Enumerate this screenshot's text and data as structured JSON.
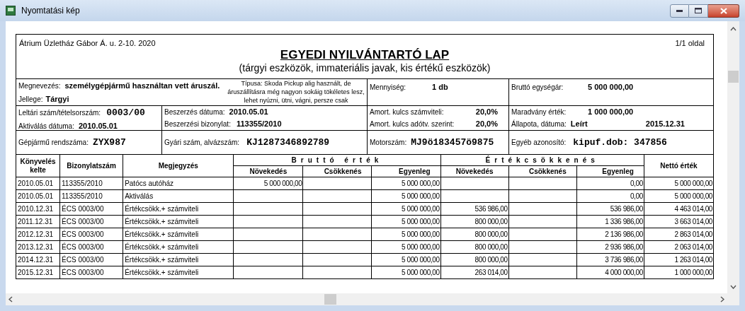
{
  "window": {
    "title": "Nyomtatási kép"
  },
  "document": {
    "company": "Átrium Üzletház Gábor Á. u. 2-10. 2020",
    "page": "1/1 oldal",
    "title": "EGYEDI NYILVÁNTARTÓ LAP",
    "subtitle": "(tárgyi eszközök, immateriális javak, kis értékű eszközök)"
  },
  "info": {
    "name": {
      "label": "Megnevezés:",
      "value": "személygépjármű használtan vett áruszál."
    },
    "character": {
      "label": "Jellege:",
      "value": "Tárgyi"
    },
    "type_note": "Típusa: Skoda Pickup alig használt, de áruszállításra még nagyon sokáig tökéletes lesz, lehet nyúzni, ütni, vágni, persze csak",
    "quantity": {
      "label": "Mennyiség:",
      "value": "1 db"
    },
    "unit_price": {
      "label": "Bruttó egységár:",
      "value": "5 000 000,00"
    },
    "inventory_no": {
      "label": "Leltári szám/tételsorszám:",
      "value": "0003/00"
    },
    "activation_date": {
      "label": "Aktiválás dátuma:",
      "value": "2010.05.01"
    },
    "purchase_date": {
      "label": "Beszerzés dátuma:",
      "value": "2010.05.01"
    },
    "purchase_doc": {
      "label": "Beszerzési bizonylat:",
      "value": "113355/2010"
    },
    "amort_accounting": {
      "label": "Amort. kulcs számviteli:",
      "value": "20,0%"
    },
    "amort_tax": {
      "label": "Amort. kulcs adótv. szerint:",
      "value": "20,0%"
    },
    "residual": {
      "label": "Maradvány érték:",
      "value": "1 000 000,00"
    },
    "status": {
      "label": "Állapota, dátuma:",
      "value": "Leírt",
      "date": "2015.12.31"
    },
    "plate": {
      "label": "Gépjármű rendszáma:",
      "value": "ZYX987"
    },
    "serial": {
      "label": "Gyári szám, alvázszám:",
      "value": "KJ1287346892789"
    },
    "engine": {
      "label": "Motorszám:",
      "value": "MJ9ö183457ö9875"
    },
    "other_id": {
      "label": "Egyéb azonosító:",
      "value": "kipuf.dob: 347856"
    }
  },
  "table": {
    "columns": [
      {
        "kind": "single",
        "label": "Könyvelés kelte"
      },
      {
        "kind": "single",
        "label": "Bizonylatszám"
      },
      {
        "kind": "single",
        "label": "Megjegyzés"
      },
      {
        "kind": "group",
        "label": "Bruttó érték",
        "colspan": 3,
        "children": [
          {
            "label": "Növekedés"
          },
          {
            "label": "Csökkenés"
          },
          {
            "label": "Egyenleg"
          }
        ]
      },
      {
        "kind": "group",
        "label": "Értékcsökkenés",
        "colspan": 3,
        "children": [
          {
            "label": "Növekedés"
          },
          {
            "label": "Csökkenés"
          },
          {
            "label": "Egyenleg"
          }
        ]
      },
      {
        "kind": "single",
        "label": "Nettó érték"
      }
    ],
    "rows": [
      [
        "2010.05.01",
        "113355/2010",
        "Patócs autóház",
        "5 000 000,00",
        null,
        "5 000 000,00",
        null,
        null,
        "0,00",
        "5 000 000,00"
      ],
      [
        "2010.05.01",
        "113355/2010",
        "Aktiválás",
        null,
        null,
        "5 000 000,00",
        null,
        null,
        "0,00",
        "5 000 000,00"
      ],
      [
        "2010.12.31",
        "ÉCS 0003/00",
        "Értékcsökk.+ számviteli",
        null,
        null,
        "5 000 000,00",
        "536 986,00",
        null,
        "536 986,00",
        "4 463 014,00"
      ],
      [
        "2011.12.31",
        "ÉCS 0003/00",
        "Értékcsökk.+ számviteli",
        null,
        null,
        "5 000 000,00",
        "800 000,00",
        null,
        "1 336 986,00",
        "3 663 014,00"
      ],
      [
        "2012.12.31",
        "ÉCS 0003/00",
        "Értékcsökk.+ számviteli",
        null,
        null,
        "5 000 000,00",
        "800 000,00",
        null,
        "2 136 986,00",
        "2 863 014,00"
      ],
      [
        "2013.12.31",
        "ÉCS 0003/00",
        "Értékcsökk.+ számviteli",
        null,
        null,
        "5 000 000,00",
        "800 000,00",
        null,
        "2 936 986,00",
        "2 063 014,00"
      ],
      [
        "2014.12.31",
        "ÉCS 0003/00",
        "Értékcsökk.+ számviteli",
        null,
        null,
        "5 000 000,00",
        "800 000,00",
        null,
        "3 736 986,00",
        "1 263 014,00"
      ],
      [
        "2015.12.31",
        "ÉCS 0003/00",
        "Értékcsökk.+ számviteli",
        null,
        null,
        "5 000 000,00",
        "263 014,00",
        null,
        "4 000 000,00",
        "1 000 000,00"
      ]
    ]
  }
}
